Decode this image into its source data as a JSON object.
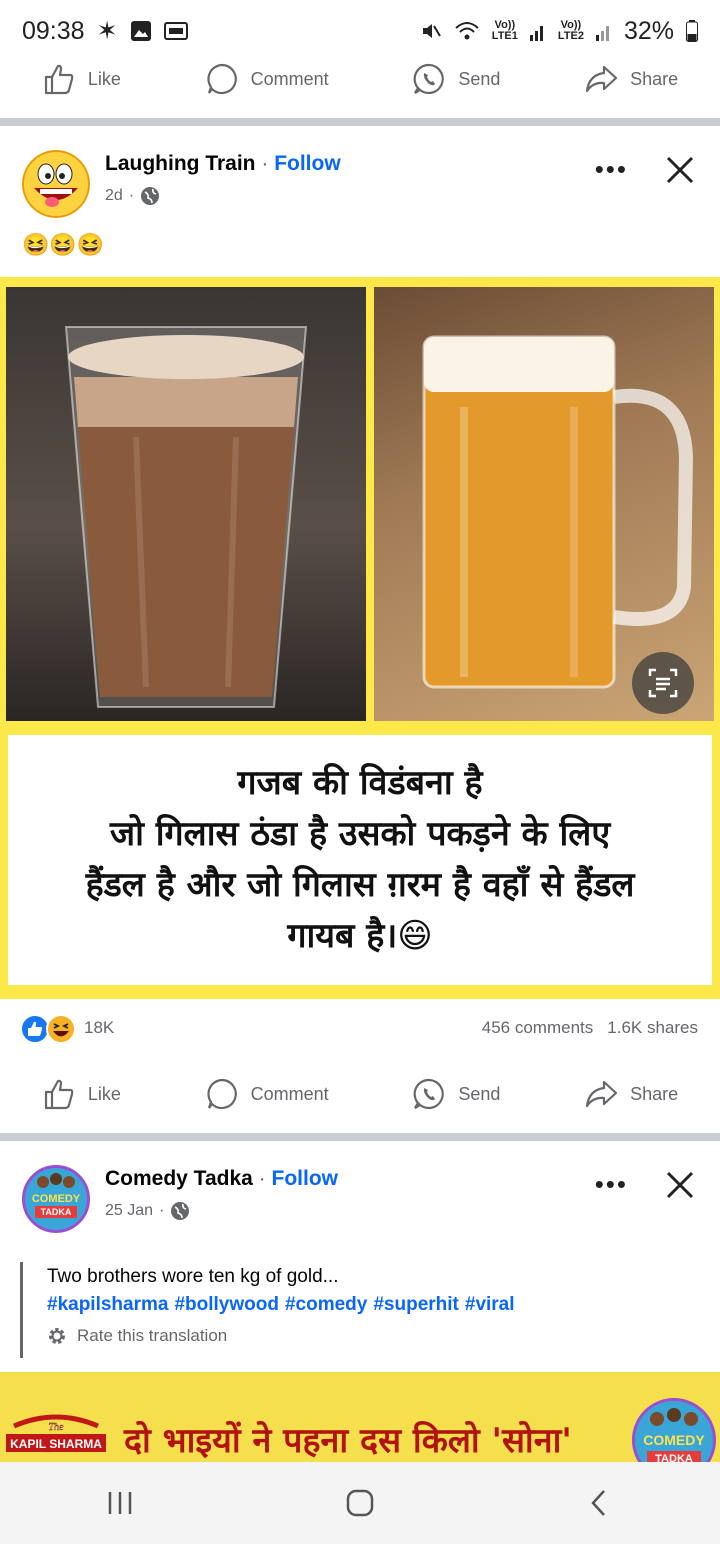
{
  "status_bar": {
    "time": "09:38",
    "net1": "Vo))",
    "net1_sub": "LTE1",
    "net2": "Vo))",
    "net2_sub": "LTE2",
    "battery": "32%"
  },
  "top_actions": {
    "like": "Like",
    "comment": "Comment",
    "send": "Send",
    "share": "Share"
  },
  "post1": {
    "author": "Laughing Train",
    "separator": "·",
    "follow": "Follow",
    "time": "2d",
    "meta_dot": "·",
    "text_emoji": "😆😆😆",
    "caption_lines": [
      "गजब की विडंबना है",
      "जो गिलास ठंडा है उसको पकड़ने के लिए",
      "हैंडल है और जो गिलास ग़रम है वहाँ से हैंडल",
      "गायब है।😄"
    ],
    "reaction_count": "18K",
    "comments": "456 comments",
    "shares": "1.6K shares",
    "actions": {
      "like": "Like",
      "comment": "Comment",
      "send": "Send",
      "share": "Share"
    }
  },
  "post2": {
    "author": "Comedy Tadka",
    "separator": "·",
    "follow": "Follow",
    "time": "25 Jan",
    "meta_dot": "·",
    "text": "Two brothers wore ten kg of gold...",
    "hashtags": [
      "#kapilsharma",
      "#bollywood",
      "#comedy",
      "#superhit",
      "#viral"
    ],
    "rate": "Rate this translation",
    "banner_text": "दो भाइयों ने पहना दस किलो 'सोना'",
    "avatar_text": [
      "COMEDY",
      "TADKA"
    ],
    "banner_logo": [
      "The",
      "KAPIL SHARMA"
    ]
  },
  "colors": {
    "brand": "#0866ff",
    "meme_bg": "#fde84a",
    "banner_bg": "#f6df4d",
    "banner_text": "#b21212"
  }
}
